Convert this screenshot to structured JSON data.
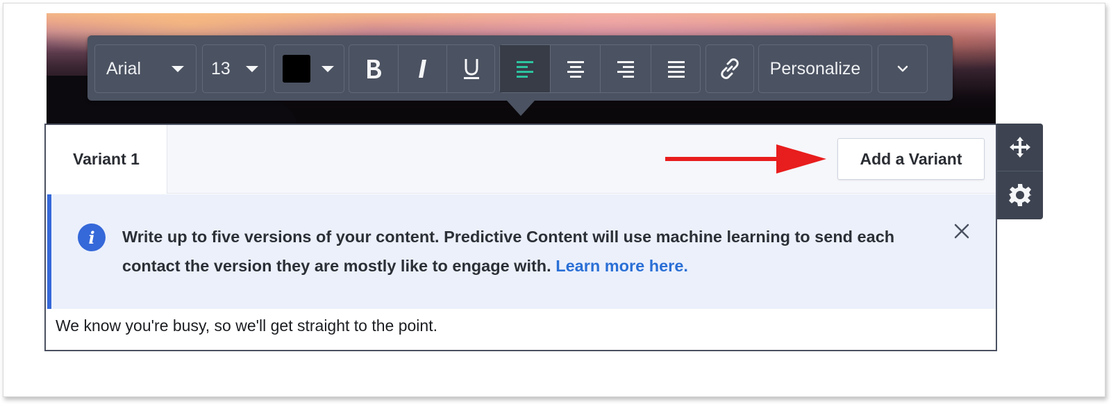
{
  "toolbar": {
    "font_family": "Arial",
    "font_size": "13",
    "text_color": "#000000",
    "buttons": {
      "bold_icon": "bold-icon",
      "italic_icon": "italic-icon",
      "underline_icon": "underline-icon",
      "align_left_icon": "align-left-icon",
      "align_center_icon": "align-center-icon",
      "align_right_icon": "align-right-icon",
      "align_justify_icon": "align-justify-icon",
      "link_icon": "link-icon",
      "more_icon": "chevron-down-icon"
    },
    "active_alignment": "left",
    "active_color": "#2ec4a0",
    "personalize_label": "Personalize"
  },
  "block": {
    "tabs": [
      {
        "label": "Variant 1",
        "active": true
      }
    ],
    "add_variant_label": "Add a Variant",
    "info": {
      "text": "Write up to five versions of your content. Predictive Content will use machine learning to send each contact the version they are mostly like to engage with.",
      "link_text": "Learn more here."
    },
    "body_text": "We know you're busy, so we'll get straight to the point."
  },
  "side_tools": [
    "move-icon",
    "gear-icon"
  ],
  "colors": {
    "toolbar_bg": "#4b5261",
    "info_accent": "#3568d9",
    "link": "#2a6fd6",
    "arrow": "#e81d1d"
  }
}
